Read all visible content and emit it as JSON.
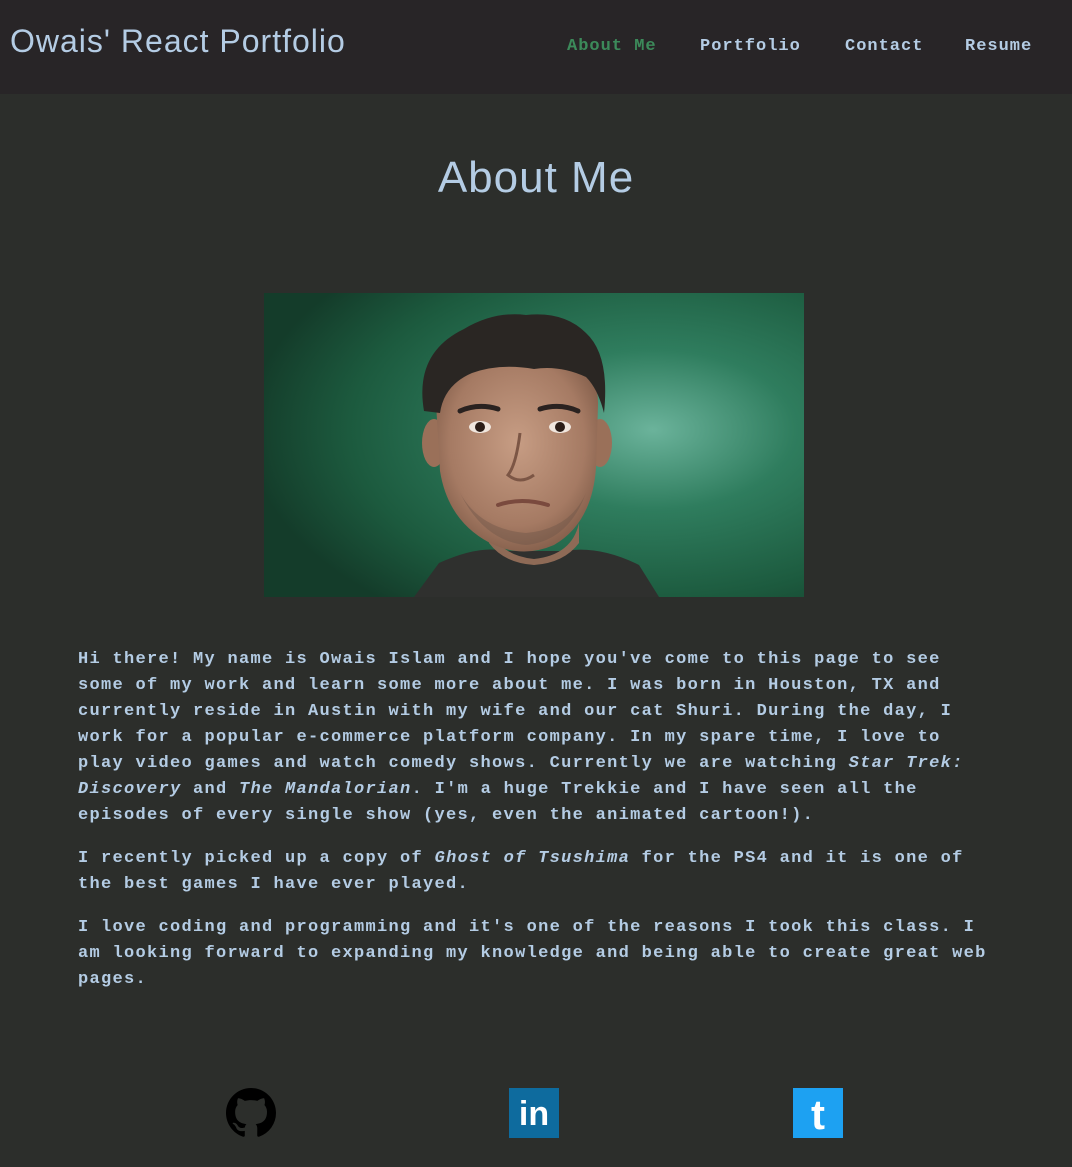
{
  "header": {
    "brand": "Owais' React Portfolio",
    "nav": [
      {
        "label": "About Me",
        "active": true
      },
      {
        "label": "Portfolio",
        "active": false
      },
      {
        "label": "Contact",
        "active": false
      },
      {
        "label": "Resume",
        "active": false
      }
    ]
  },
  "main": {
    "title": "About Me",
    "bio": {
      "p1": {
        "a": "Hi there! My name is Owais Islam and I hope you've come to this page to see some of my work and learn some more about me. I was born in Houston, TX and currently reside in Austin with my wife and our cat Shuri. During the day, I work for a popular e-commerce platform company. In my spare time, I love to play video games and watch comedy shows. Currently we are watching ",
        "show1": "Star Trek: Discovery",
        "b": " and ",
        "show2": "The Mandalorian",
        "c": ". I'm a huge Trekkie and I have seen all the episodes of every single show (yes, even the animated cartoon!)."
      },
      "p2": {
        "a": "I recently picked up a copy of ",
        "game": "Ghost of Tsushima",
        "b": " for the PS4 and it is one of the best games I have ever played."
      },
      "p3": "I love coding and programming and it's one of the reasons I took this class. I am looking forward to expanding my knowledge and being able to create great web pages."
    }
  },
  "social": [
    {
      "name": "github-icon"
    },
    {
      "name": "linkedin-icon",
      "text": "in",
      "color": "#0e6b9e"
    },
    {
      "name": "twitter-icon",
      "text": "t",
      "color": "#1da1f2"
    }
  ],
  "colors": {
    "background": "#2c2e2b",
    "navbar": "#282527",
    "text": "#b4cce4",
    "active_link": "#3c8a5a"
  }
}
